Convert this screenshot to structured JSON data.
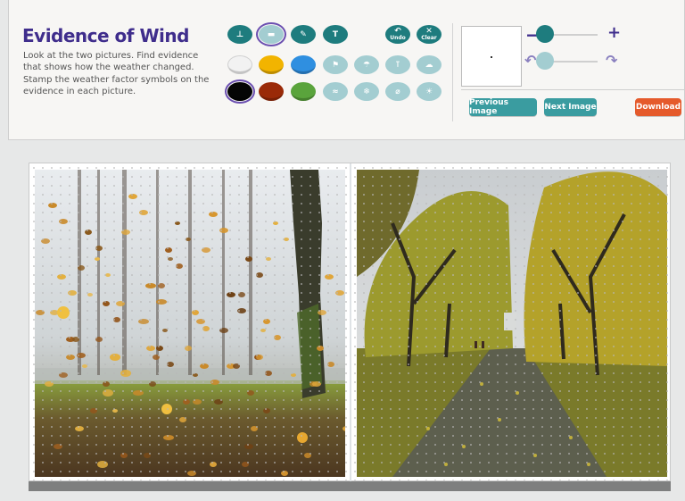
{
  "activity": {
    "title": "Evidence of Wind",
    "instructions": "Look at the two pictures. Find evidence that shows how the weather changed. Stamp the weather factor symbols on the evidence in each picture."
  },
  "tools": {
    "row1": [
      {
        "name": "stamp-tool-icon",
        "glyph": "⊥",
        "selected": false
      },
      {
        "name": "highlighter-tool-icon",
        "glyph": "▬",
        "selected": true
      },
      {
        "name": "marker-tool-icon",
        "glyph": "✎",
        "selected": false
      },
      {
        "name": "text-tool-icon",
        "glyph": "T",
        "selected": false
      }
    ],
    "undo_label": "Undo",
    "clear_label": "Clear"
  },
  "colors": {
    "swatches": [
      {
        "name": "white-swatch",
        "hex": "#f2f2f2",
        "selected": false
      },
      {
        "name": "yellow-swatch",
        "hex": "#f2b400",
        "selected": false
      },
      {
        "name": "blue-swatch",
        "hex": "#2f8fe0",
        "selected": false
      },
      {
        "name": "black-swatch",
        "hex": "#050505",
        "selected": true
      },
      {
        "name": "red-swatch",
        "hex": "#9a2a08",
        "selected": false
      },
      {
        "name": "green-swatch",
        "hex": "#5aa43c",
        "selected": false
      }
    ],
    "accent": "#3f2d8c",
    "teal": "#1e7c7e",
    "orange": "#e55a2b"
  },
  "weather_stamps": {
    "row1": [
      "wind-sock-icon",
      "rain-cloud-icon",
      "temperature-icon",
      "cloud-icon"
    ],
    "row2": [
      "wind-icon",
      "snow-cloud-icon",
      "thermometer-icon",
      "sun-icon"
    ]
  },
  "controls": {
    "size_minus": "−",
    "size_plus": "+",
    "rotate_left": "↶",
    "rotate_right": "↷"
  },
  "buttons": {
    "previous": "Previous Image",
    "next": "Next Image",
    "download": "Download"
  }
}
